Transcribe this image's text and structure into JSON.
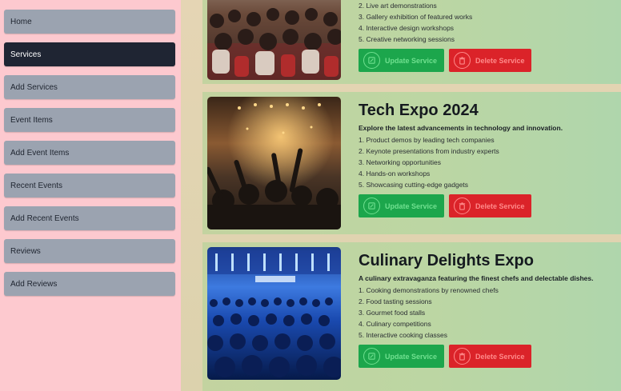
{
  "sidebar": {
    "items": [
      {
        "label": "Home"
      },
      {
        "label": "Services"
      },
      {
        "label": "Add Services"
      },
      {
        "label": "Event Items"
      },
      {
        "label": "Add Event Items"
      },
      {
        "label": "Recent Events"
      },
      {
        "label": "Add Recent Events"
      },
      {
        "label": "Reviews"
      },
      {
        "label": "Add Reviews"
      }
    ],
    "active": "Services"
  },
  "cards": [
    {
      "title": "",
      "description": "",
      "features": [
        "2. Live art demonstrations",
        "3. Gallery exhibition of featured works",
        "4. Interactive design workshops",
        "5. Creative networking sessions"
      ],
      "update_label": "Update Service",
      "delete_label": "Delete Service"
    },
    {
      "title": "Tech Expo 2024",
      "description": "Explore the latest advancements in technology and innovation.",
      "features": [
        "1. Product demos by leading tech companies",
        "2. Keynote presentations from industry experts",
        "3. Networking opportunities",
        "4. Hands-on workshops",
        "5. Showcasing cutting-edge gadgets"
      ],
      "update_label": "Update Service",
      "delete_label": "Delete Service"
    },
    {
      "title": "Culinary Delights Expo",
      "description": "A culinary extravaganza featuring the finest chefs and delectable dishes.",
      "features": [
        "1. Cooking demonstrations by renowned chefs",
        "2. Food tasting sessions",
        "3. Gourmet food stalls",
        "4. Culinary competitions",
        "5. Interactive cooking classes"
      ],
      "update_label": "Update Service",
      "delete_label": "Delete Service"
    }
  ],
  "colors": {
    "sidebar_bg": "#fdc9cf",
    "nav_button": "#9ba3b0",
    "nav_active": "#1f2533",
    "update_button": "#1ca64c",
    "delete_button": "#db2329"
  }
}
